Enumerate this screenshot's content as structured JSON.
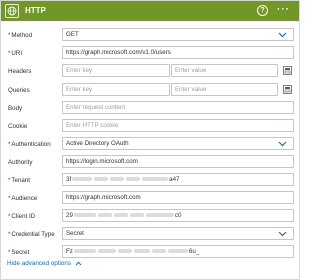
{
  "header": {
    "title": "HTTP",
    "logo_icon": "globe-icon",
    "help_label": "?",
    "more_label": "···",
    "color": "#709727"
  },
  "fields": {
    "method": {
      "label": "Method",
      "value": "GET"
    },
    "uri": {
      "label": "URI",
      "value": "https://graph.microsoft.com/v1.0/users"
    },
    "headers": {
      "label": "Headers",
      "key_placeholder": "Enter key",
      "value_placeholder": "Enter value"
    },
    "queries": {
      "label": "Queries",
      "key_placeholder": "Enter key",
      "value_placeholder": "Enter value"
    },
    "body": {
      "label": "Body",
      "placeholder": "Enter request content"
    },
    "cookie": {
      "label": "Cookie",
      "placeholder": "Enter HTTP cookie"
    },
    "authentication": {
      "label": "Authentication",
      "value": "Active Directory OAuth"
    },
    "authority": {
      "label": "Authority",
      "value": "https://login.microsoft.com"
    },
    "tenant": {
      "label": "Tenant",
      "value_start": "3f",
      "value_end": "a47"
    },
    "audience": {
      "label": "Audience",
      "value": "https://graph.microsoft.com"
    },
    "client_id": {
      "label": "Client ID",
      "value_start": "29",
      "value_end": "c0"
    },
    "credential_type": {
      "label": "Credential Type",
      "value": "Secret"
    },
    "secret": {
      "label": "Secret",
      "value_start": "Fz",
      "value_end": "6u_"
    }
  },
  "advanced_label": "Hide advanced options",
  "colors": {
    "required": "#a4262c",
    "link": "#0f6cbd",
    "border": "#c8c6c4"
  }
}
